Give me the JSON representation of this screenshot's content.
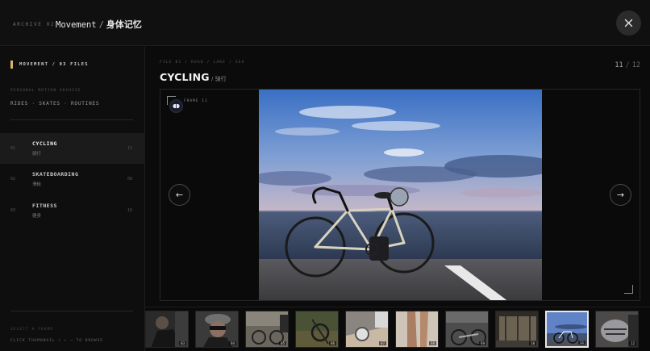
{
  "header": {
    "archive_label": "ARCHIVE 02",
    "title_en": "Movement",
    "separator": "/",
    "title_cn": "身体记忆",
    "close_icon": "close-icon"
  },
  "sidebar": {
    "heading": "MOVEMENT / 03 FILES",
    "subtitle": "PERSONAL MOTION ARCHIVE",
    "tags": "RIDES · SKATES · ROUTINES",
    "items": [
      {
        "num": "01",
        "label": "CYCLING",
        "cn": "骑行",
        "count": "12",
        "active": true
      },
      {
        "num": "02",
        "label": "SKATEBOARDING",
        "cn": "滑板",
        "count": "08",
        "active": false
      },
      {
        "num": "03",
        "label": "FITNESS",
        "cn": "健身",
        "count": "10",
        "active": false
      }
    ],
    "footer_title": "SELECT A FRAME",
    "footer_hint": "CLICK THUMBNAIL / ← → TO BROWSE"
  },
  "viewer": {
    "file_meta": "FILE 01 / ROAD / LAKE / SEA",
    "title": "CYCLING",
    "title_sub": "/ 骑行",
    "counter_current": "11",
    "counter_sep": "/",
    "counter_total": "12",
    "frame_label": "FRAME 11",
    "prev_arrow": "←",
    "next_arrow": "→"
  },
  "thumbnails": [
    {
      "num": "03",
      "scene": "cyclist-dark"
    },
    {
      "num": "04",
      "scene": "helmet-face"
    },
    {
      "num": "05",
      "scene": "bike-garage"
    },
    {
      "num": "06",
      "scene": "wheel-grass"
    },
    {
      "num": "07",
      "scene": "watch-wrist"
    },
    {
      "num": "08",
      "scene": "legs-floor"
    },
    {
      "num": "09",
      "scene": "bike-lying"
    },
    {
      "num": "10",
      "scene": "bike-shelter"
    },
    {
      "num": "11",
      "scene": "bike-sea",
      "active": true
    },
    {
      "num": "12",
      "scene": "helmet-closeup"
    }
  ],
  "colors": {
    "accent": "#d6b56a",
    "background": "#0b0b0b",
    "panel": "#0e0e0e"
  }
}
